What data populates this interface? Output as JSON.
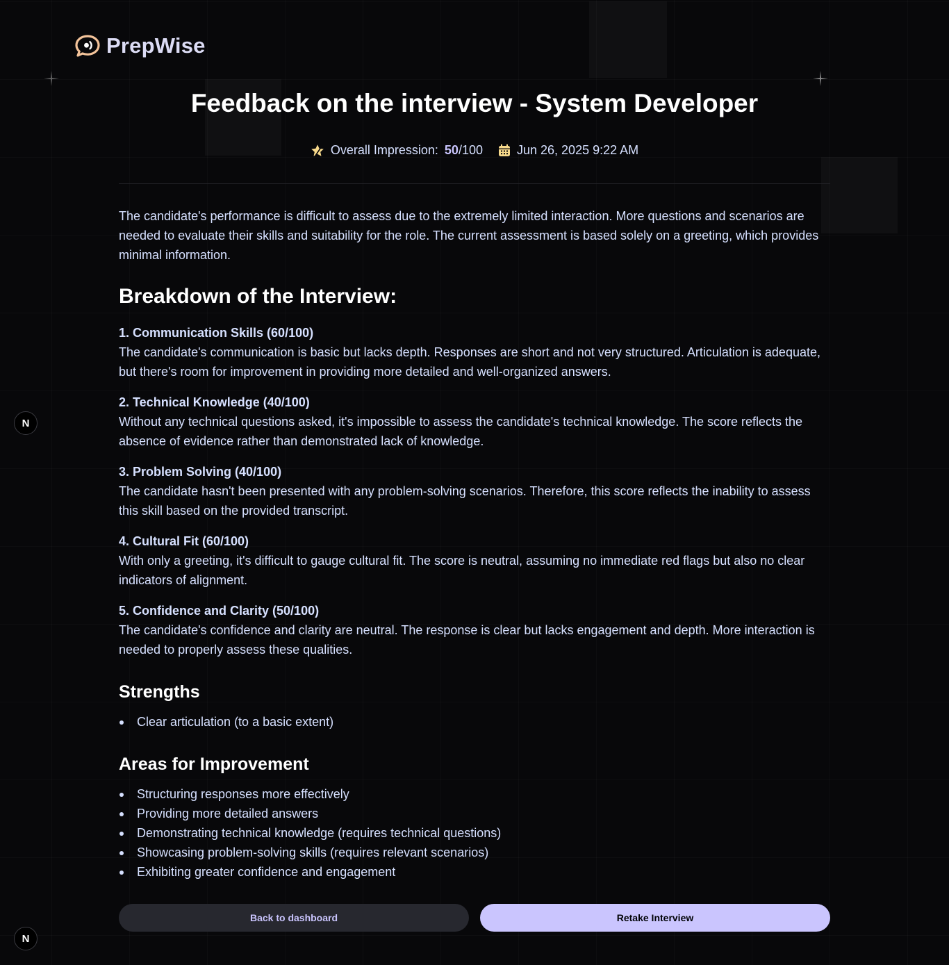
{
  "brand": {
    "name": "PrepWise",
    "icon": "chat-bubble-icon"
  },
  "feedback": {
    "title": "Feedback on the interview - System Developer",
    "impression_label": "Overall Impression:",
    "score": "50",
    "score_suffix": "/100",
    "date": "Jun 26, 2025 9:22 AM",
    "summary": "The candidate's performance is difficult to assess due to the extremely limited interaction. More questions and scenarios are needed to evaluate their skills and suitability for the role. The current assessment is based solely on a greeting, which provides minimal information."
  },
  "breakdown": {
    "title": "Breakdown of the Interview:",
    "categories": [
      {
        "title": "1. Communication Skills (60/100)",
        "comment": "The candidate's communication is basic but lacks depth. Responses are short and not very structured. Articulation is adequate, but there's room for improvement in providing more detailed and well-organized answers."
      },
      {
        "title": "2. Technical Knowledge (40/100)",
        "comment": "Without any technical questions asked, it's impossible to assess the candidate's technical knowledge. The score reflects the absence of evidence rather than demonstrated lack of knowledge."
      },
      {
        "title": "3. Problem Solving (40/100)",
        "comment": "The candidate hasn't been presented with any problem-solving scenarios. Therefore, this score reflects the inability to assess this skill based on the provided transcript."
      },
      {
        "title": "4. Cultural Fit (60/100)",
        "comment": "With only a greeting, it's difficult to gauge cultural fit. The score is neutral, assuming no immediate red flags but also no clear indicators of alignment."
      },
      {
        "title": "5. Confidence and Clarity (50/100)",
        "comment": "The candidate's confidence and clarity are neutral. The response is clear but lacks engagement and depth. More interaction is needed to properly assess these qualities."
      }
    ]
  },
  "strengths": {
    "title": "Strengths",
    "items": [
      "Clear articulation (to a basic extent)"
    ]
  },
  "improvements": {
    "title": "Areas for Improvement",
    "items": [
      "Structuring responses more effectively",
      "Providing more detailed answers",
      "Demonstrating technical knowledge (requires technical questions)",
      "Showcasing problem-solving skills (requires relevant scenarios)",
      "Exhibiting greater confidence and engagement"
    ]
  },
  "actions": {
    "back_label": "Back to dashboard",
    "retake_label": "Retake Interview"
  },
  "dev_badge": {
    "label": "N"
  },
  "colors": {
    "background": "#08080a",
    "accent": "#cac5fe",
    "text_light": "#d6e0ff",
    "button_dark": "#27282f"
  }
}
